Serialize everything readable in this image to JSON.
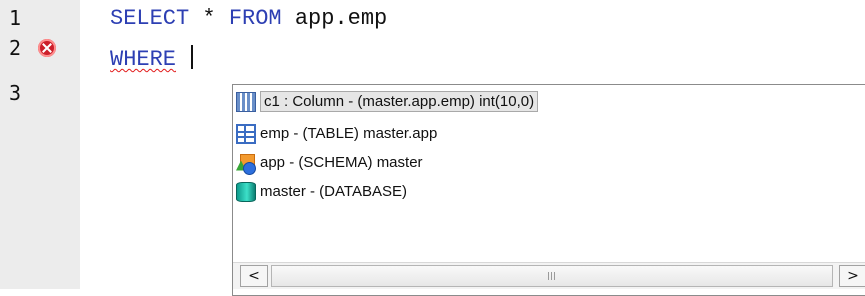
{
  "gutter": {
    "line_numbers": [
      "1",
      "2",
      "3"
    ]
  },
  "editor": {
    "line1": {
      "kw1": "SELECT",
      "op": "*",
      "kw2": "FROM",
      "ident": "app.emp"
    },
    "line2": {
      "kw": "WHERE",
      "error_icon": "error-circle-icon"
    }
  },
  "autocomplete": {
    "items": [
      {
        "label": "c1 : Column - (master.app.emp) int(10,0)",
        "icon": "column-icon",
        "selected": true
      },
      {
        "label": "emp - (TABLE) master.app",
        "icon": "table-icon"
      },
      {
        "label": "app - (SCHEMA) master",
        "icon": "schema-icon"
      },
      {
        "label": "master - (DATABASE)",
        "icon": "database-icon"
      }
    ],
    "scrollbar": {
      "left_arrow": "<",
      "right_arrow": ">"
    }
  },
  "colors": {
    "keyword": "#2d3fb3",
    "error": "#cc1f2a",
    "gutter_bg": "#ececec"
  }
}
